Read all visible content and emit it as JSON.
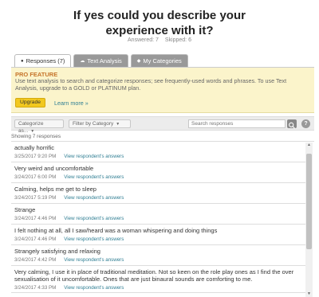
{
  "question": {
    "title": "If yes could you describe your experience with it?",
    "answered": "Answered: 7",
    "skipped": "Skipped: 6"
  },
  "tabs": [
    {
      "label": "Responses (7)",
      "icon": "speech-bubble-icon",
      "active": true
    },
    {
      "label": "Text Analysis",
      "icon": "cloud-icon",
      "active": false
    },
    {
      "label": "My Categories",
      "icon": "tag-icon",
      "active": false
    }
  ],
  "pro_feature": {
    "heading": "PRO FEATURE",
    "text": "Use text analysis to search and categorize responses; see frequently-used words and phrases. To use Text Analysis, upgrade to a GOLD or PLATINUM plan.",
    "upgrade_label": "Upgrade",
    "learn_more_label": "Learn more »"
  },
  "filters": {
    "categorize_label": "Categorize as...",
    "filter_label": "Filter by Category",
    "search_placeholder": "Search responses",
    "help_label": "?"
  },
  "showing_text": "Showing 7 responses",
  "view_link_label": "View respondent's answers",
  "responses": [
    {
      "text": "actually horrific",
      "timestamp": "3/25/2017 9:20 PM"
    },
    {
      "text": "Very weird and uncomfortable",
      "timestamp": "3/24/2017 6:00 PM"
    },
    {
      "text": "Calming, helps me get to sleep",
      "timestamp": "3/24/2017 5:19 PM"
    },
    {
      "text": "Strange",
      "timestamp": "3/24/2017 4:46 PM"
    },
    {
      "text": "I felt nothing at all, all I saw/heard was a woman whispering and doing things",
      "timestamp": "3/24/2017 4:46 PM"
    },
    {
      "text": "Strangely satisfying and relaxing",
      "timestamp": "3/24/2017 4:42 PM"
    },
    {
      "text": "Very calming, I use it in place of traditional meditation. Not so keen on the role play ones as I find the over sexualisation of it uncomfortable. Ones that are just binaural sounds are comforting to me.",
      "timestamp": "3/24/2017 4:33 PM"
    }
  ],
  "colors": {
    "pro_bg": "#fbf4cb",
    "pro_heading": "#c6742a",
    "link": "#2f7e93",
    "upgrade_button": "#f2c81e"
  }
}
